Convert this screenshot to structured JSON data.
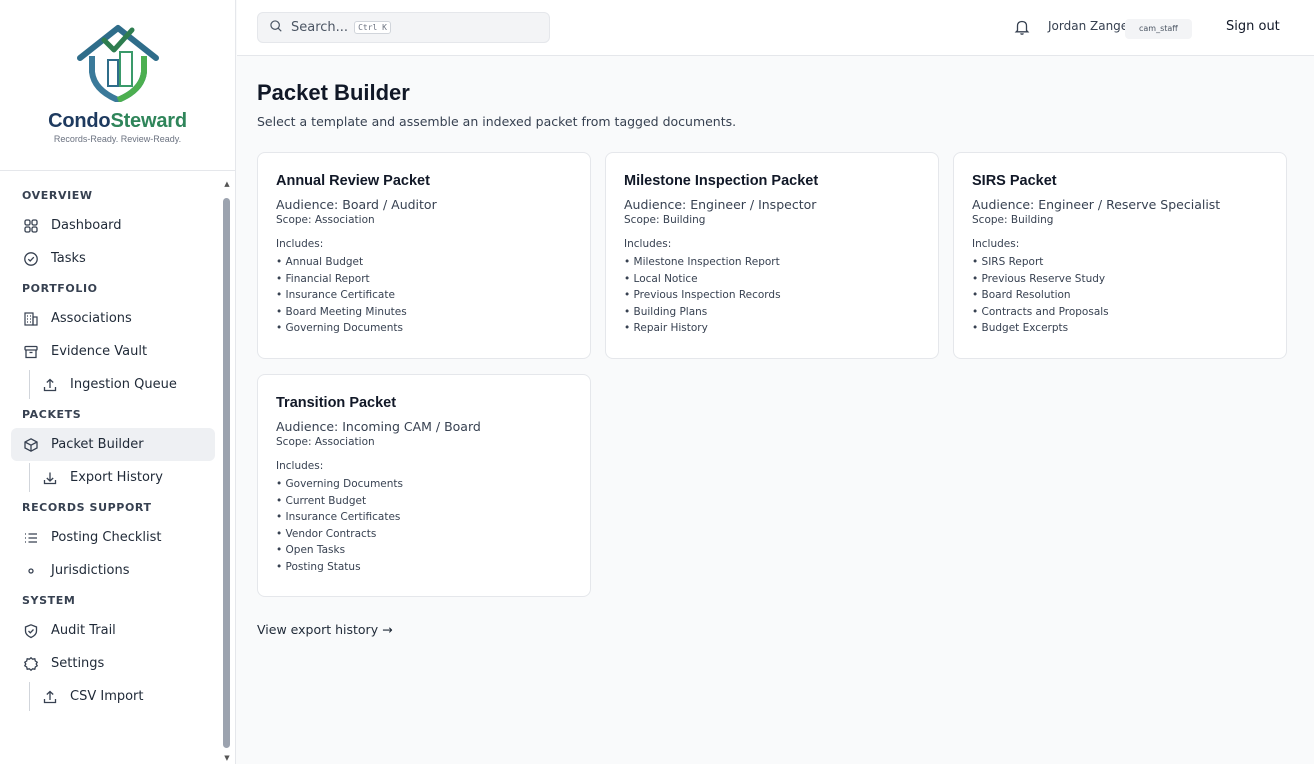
{
  "brand": {
    "name_part1": "Condo",
    "name_part2": "Steward",
    "tagline": "Records-Ready. Review-Ready.",
    "color_primary": "#1e3a5f",
    "color_accent": "#2f855a"
  },
  "sidebar": {
    "sections": [
      {
        "label": "OVERVIEW",
        "items": [
          {
            "label": "Dashboard",
            "icon": "grid-icon"
          },
          {
            "label": "Tasks",
            "icon": "check-circle-icon"
          }
        ]
      },
      {
        "label": "PORTFOLIO",
        "items": [
          {
            "label": "Associations",
            "icon": "building-icon"
          },
          {
            "label": "Evidence Vault",
            "icon": "archive-icon"
          },
          {
            "label": "Ingestion Queue",
            "icon": "upload-icon",
            "sub": true
          }
        ]
      },
      {
        "label": "PACKETS",
        "items": [
          {
            "label": "Packet Builder",
            "icon": "package-icon",
            "active": true
          },
          {
            "label": "Export History",
            "icon": "download-icon",
            "sub": true
          }
        ]
      },
      {
        "label": "RECORDS SUPPORT",
        "items": [
          {
            "label": "Posting Checklist",
            "icon": "list-icon"
          },
          {
            "label": "Jurisdictions",
            "icon": "dot-icon"
          }
        ]
      },
      {
        "label": "SYSTEM",
        "items": [
          {
            "label": "Audit Trail",
            "icon": "shield-check-icon"
          },
          {
            "label": "Settings",
            "icon": "gear-icon"
          },
          {
            "label": "CSV Import",
            "icon": "upload-icon",
            "sub": true
          }
        ]
      }
    ]
  },
  "topbar": {
    "search_placeholder": "Search...",
    "search_shortcut": "Ctrl K",
    "user_name": "Jordan Zanger",
    "user_role": "cam_staff",
    "sign_out": "Sign out"
  },
  "page": {
    "title": "Packet Builder",
    "subtitle": "Select a template and assemble an indexed packet from tagged documents.",
    "includes_label": "Includes:",
    "export_link": "View export history →"
  },
  "templates": [
    {
      "title": "Annual Review Packet",
      "audience": "Audience: Board / Auditor",
      "scope": "Scope: Association",
      "includes": [
        "Annual Budget",
        "Financial Report",
        "Insurance Certificate",
        "Board Meeting Minutes",
        "Governing Documents"
      ]
    },
    {
      "title": "Milestone Inspection Packet",
      "audience": "Audience: Engineer / Inspector",
      "scope": "Scope: Building",
      "includes": [
        "Milestone Inspection Report",
        "Local Notice",
        "Previous Inspection Records",
        "Building Plans",
        "Repair History"
      ]
    },
    {
      "title": "SIRS Packet",
      "audience": "Audience: Engineer / Reserve Specialist",
      "scope": "Scope: Building",
      "includes": [
        "SIRS Report",
        "Previous Reserve Study",
        "Board Resolution",
        "Contracts and Proposals",
        "Budget Excerpts"
      ]
    },
    {
      "title": "Transition Packet",
      "audience": "Audience: Incoming CAM / Board",
      "scope": "Scope: Association",
      "includes": [
        "Governing Documents",
        "Current Budget",
        "Insurance Certificates",
        "Vendor Contracts",
        "Open Tasks",
        "Posting Status"
      ]
    }
  ]
}
